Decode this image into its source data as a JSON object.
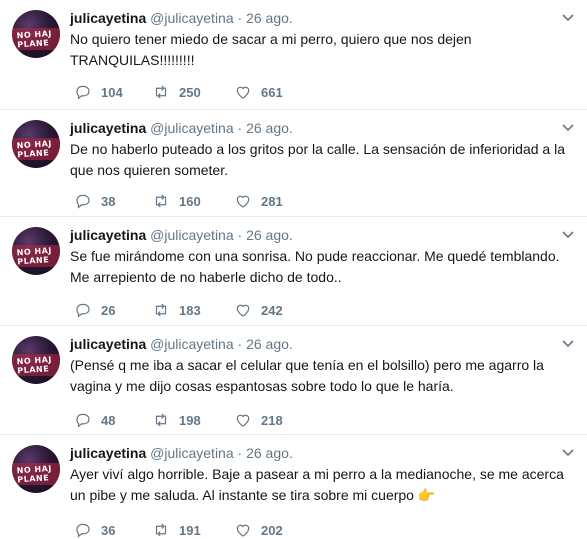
{
  "tweets": [
    {
      "name": "julicayetina",
      "handle": "@julicayetina",
      "dot": "·",
      "date": "26 ago.",
      "text": "No quiero tener miedo de sacar a mi perro, quiero que nos dejen TRANQUILAS!!!!!!!!!",
      "replies": "104",
      "retweets": "250",
      "likes": "661"
    },
    {
      "name": "julicayetina",
      "handle": "@julicayetina",
      "dot": "·",
      "date": "26 ago.",
      "text": "De no haberlo puteado a los gritos por la calle. La sensación de inferioridad a la que nos quieren someter.",
      "replies": "38",
      "retweets": "160",
      "likes": "281"
    },
    {
      "name": "julicayetina",
      "handle": "@julicayetina",
      "dot": "·",
      "date": "26 ago.",
      "text": "Se fue mirándome con una sonrisa. No pude reaccionar. Me quedé temblando. Me arrepiento de no haberle dicho de todo..",
      "replies": "26",
      "retweets": "183",
      "likes": "242"
    },
    {
      "name": "julicayetina",
      "handle": "@julicayetina",
      "dot": "·",
      "date": "26 ago.",
      "text": "(Pensé q me iba a sacar el celular que tenía en el bolsillo) pero me agarro la vagina y me dijo cosas espantosas sobre todo lo que le haría.",
      "replies": "48",
      "retweets": "198",
      "likes": "218"
    },
    {
      "name": "julicayetina",
      "handle": "@julicayetina",
      "dot": "·",
      "date": "26 ago.",
      "text": "Ayer viví algo horrible. Baje a pasear a mi perro a la medianoche, se me acerca un pibe y me saluda. Al instante se tira sobre mi cuerpo",
      "emoji": "👉",
      "replies": "36",
      "retweets": "191",
      "likes": "202"
    }
  ],
  "avatar_text": [
    "NO HAJ",
    "PLANE"
  ],
  "icons": {
    "reply": "reply-icon",
    "retweet": "retweet-icon",
    "like": "heart-icon",
    "caret": "chevron-down-icon"
  },
  "colors": {
    "text": "#14171a",
    "muted": "#657786",
    "divider": "#e6ecf0"
  }
}
